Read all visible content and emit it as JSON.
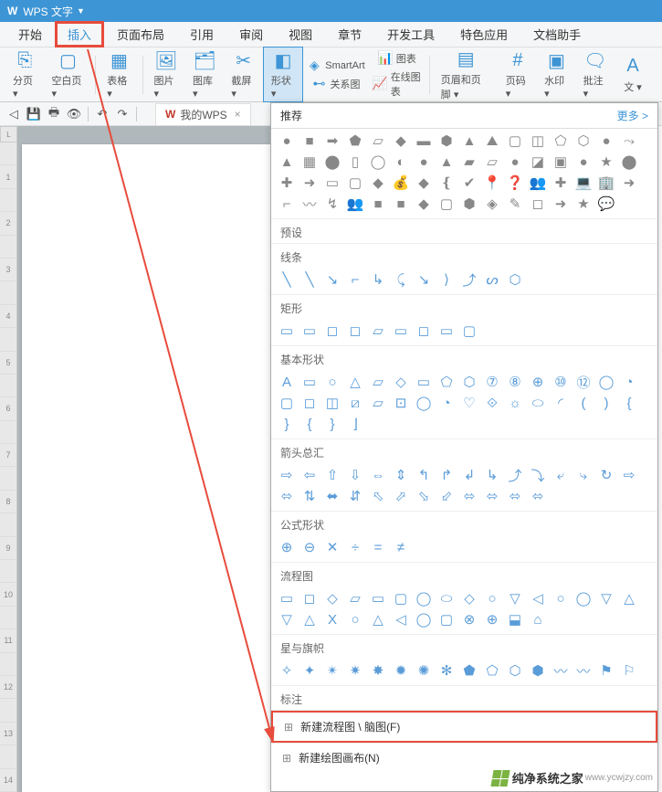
{
  "title_bar": {
    "app_name": "WPS 文字"
  },
  "menu": {
    "items": [
      "开始",
      "插入",
      "页面布局",
      "引用",
      "审阅",
      "视图",
      "章节",
      "开发工具",
      "特色应用",
      "文档助手"
    ],
    "active_index": 1
  },
  "ribbon": {
    "buttons": [
      {
        "label": "分页",
        "icon": "⎘"
      },
      {
        "label": "空白页",
        "icon": "▢"
      },
      {
        "label": "表格",
        "icon": "▦"
      },
      {
        "label": "图片",
        "icon": "🖼"
      },
      {
        "label": "图库",
        "icon": "🗂"
      },
      {
        "label": "截屏",
        "icon": "✂"
      },
      {
        "label": "形状",
        "icon": "◧",
        "selected": true
      },
      {
        "label": "页眉和页脚",
        "icon": "▤"
      },
      {
        "label": "页码",
        "icon": "#"
      },
      {
        "label": "水印",
        "icon": "▣"
      },
      {
        "label": "批注",
        "icon": "🗨"
      },
      {
        "label": "文",
        "icon": "A"
      }
    ],
    "small_buttons": [
      {
        "label": "SmartArt",
        "icon": "◈"
      },
      {
        "label": "图表",
        "icon": "📊"
      },
      {
        "label": "关系图",
        "icon": "⊷"
      },
      {
        "label": "在线图表",
        "icon": "📈"
      }
    ]
  },
  "toolbar": {
    "tab_label": "我的WPS"
  },
  "ruler": {
    "corner": "L",
    "marks": [
      "",
      "1",
      "",
      "2",
      "",
      "3",
      "",
      "4",
      "",
      "5",
      "",
      "6",
      "",
      "7",
      "",
      "8",
      "",
      "9",
      "",
      "10",
      "",
      "11",
      "",
      "12",
      "",
      "13",
      "",
      "14"
    ]
  },
  "shapes_panel": {
    "header": "推荐",
    "more": "更多 >",
    "sections": [
      {
        "title": "",
        "type": "solid",
        "count": 68
      },
      {
        "title": "预设",
        "type": "outline",
        "count": 0
      },
      {
        "title": "线条",
        "type": "outline",
        "count": 11
      },
      {
        "title": "矩形",
        "type": "outline",
        "count": 9
      },
      {
        "title": "基本形状",
        "type": "outline",
        "count": 42
      },
      {
        "title": "箭头总汇",
        "type": "outline",
        "count": 28
      },
      {
        "title": "公式形状",
        "type": "outline",
        "count": 6
      },
      {
        "title": "流程图",
        "type": "outline",
        "count": 28
      },
      {
        "title": "星与旗帜",
        "type": "outline",
        "count": 16
      },
      {
        "title": "标注",
        "type": "outline",
        "count": 0
      }
    ],
    "footer": [
      {
        "label": "新建流程图 \\ 脑图(F)",
        "highlight": true
      },
      {
        "label": "新建绘图画布(N)",
        "highlight": false
      }
    ]
  },
  "shape_glyphs": {
    "solid": [
      "●",
      "■",
      "➡",
      "⬟",
      "▱",
      "◆",
      "▬",
      "⬢",
      "▲",
      "⛰",
      "▢",
      "◫",
      "⬠",
      "⬡",
      "●",
      "⤳",
      "▲",
      "▦",
      "⬤",
      "▯",
      "◯",
      "◐",
      "●",
      "▲",
      "▰",
      "▱",
      "●",
      "◪",
      "▣",
      "●",
      "★",
      "⬤",
      "✚",
      "➜",
      "▭",
      "▢",
      "◆",
      "💰",
      "◆",
      "❴",
      "✔",
      "📍",
      "❓",
      "👥",
      "✚",
      "💻",
      "🏢",
      "➜",
      "⌐",
      "〰",
      "↯",
      "👥",
      "■",
      "■",
      "◆",
      "▢",
      "⬢",
      "◈",
      "✎",
      "◻",
      "➜",
      "★",
      "💬"
    ],
    "outline_lines": [
      "╲",
      "╲",
      "↘",
      "⌐",
      "↳",
      "⤹",
      "↘",
      "⟩",
      "⤴",
      "ᔕ",
      "⬡"
    ],
    "outline_rects": [
      "▭",
      "▭",
      "◻",
      "◻",
      "▱",
      "▭",
      "◻",
      "▭",
      "▢"
    ],
    "outline_basic": [
      "A",
      "▭",
      "○",
      "△",
      "▱",
      "◇",
      "▭",
      "⬠",
      "⬡",
      "⑦",
      "⑧",
      "⊕",
      "⑩",
      "⑫",
      "◯",
      "◔",
      "▢",
      "◻",
      "◫",
      "⧄",
      "▱",
      "⊡",
      "◯",
      "◔",
      "♡",
      "⟐",
      "☼",
      "⬭",
      "◜",
      "(",
      ")",
      "{",
      "}",
      "{",
      "}",
      "⌋"
    ],
    "outline_arrows": [
      "⇨",
      "⇦",
      "⇧",
      "⇩",
      "⇔",
      "⇕",
      "↰",
      "↱",
      "↲",
      "↳",
      "⤴",
      "⤵",
      "⤶",
      "⤷",
      "↻",
      "⇨",
      "⬄",
      "⇅",
      "⬌",
      "⇵",
      "⬁",
      "⬀",
      "⬂",
      "⬃",
      "⬄",
      "⬄",
      "⬄",
      "⬄"
    ],
    "outline_formula": [
      "⊕",
      "⊖",
      "✕",
      "÷",
      "=",
      "≠"
    ],
    "outline_flow": [
      "▭",
      "◻",
      "◇",
      "▱",
      "▭",
      "▢",
      "◯",
      "⬭",
      "◇",
      "○",
      "▽",
      "◁",
      "○",
      "◯",
      "▽",
      "△",
      "▽",
      "△",
      "X",
      "○",
      "△",
      "◁",
      "◯",
      "▢",
      "⊗",
      "⊕",
      "⬓",
      "⌂"
    ],
    "outline_stars": [
      "✧",
      "✦",
      "✴",
      "✷",
      "✸",
      "✹",
      "✺",
      "✻",
      "⬟",
      "⬠",
      "⬡",
      "⬢",
      "〰",
      "〰",
      "⚑",
      "⚐"
    ]
  },
  "watermark": {
    "text": "纯净系统之家",
    "url": "www.ycwjzy.com"
  }
}
